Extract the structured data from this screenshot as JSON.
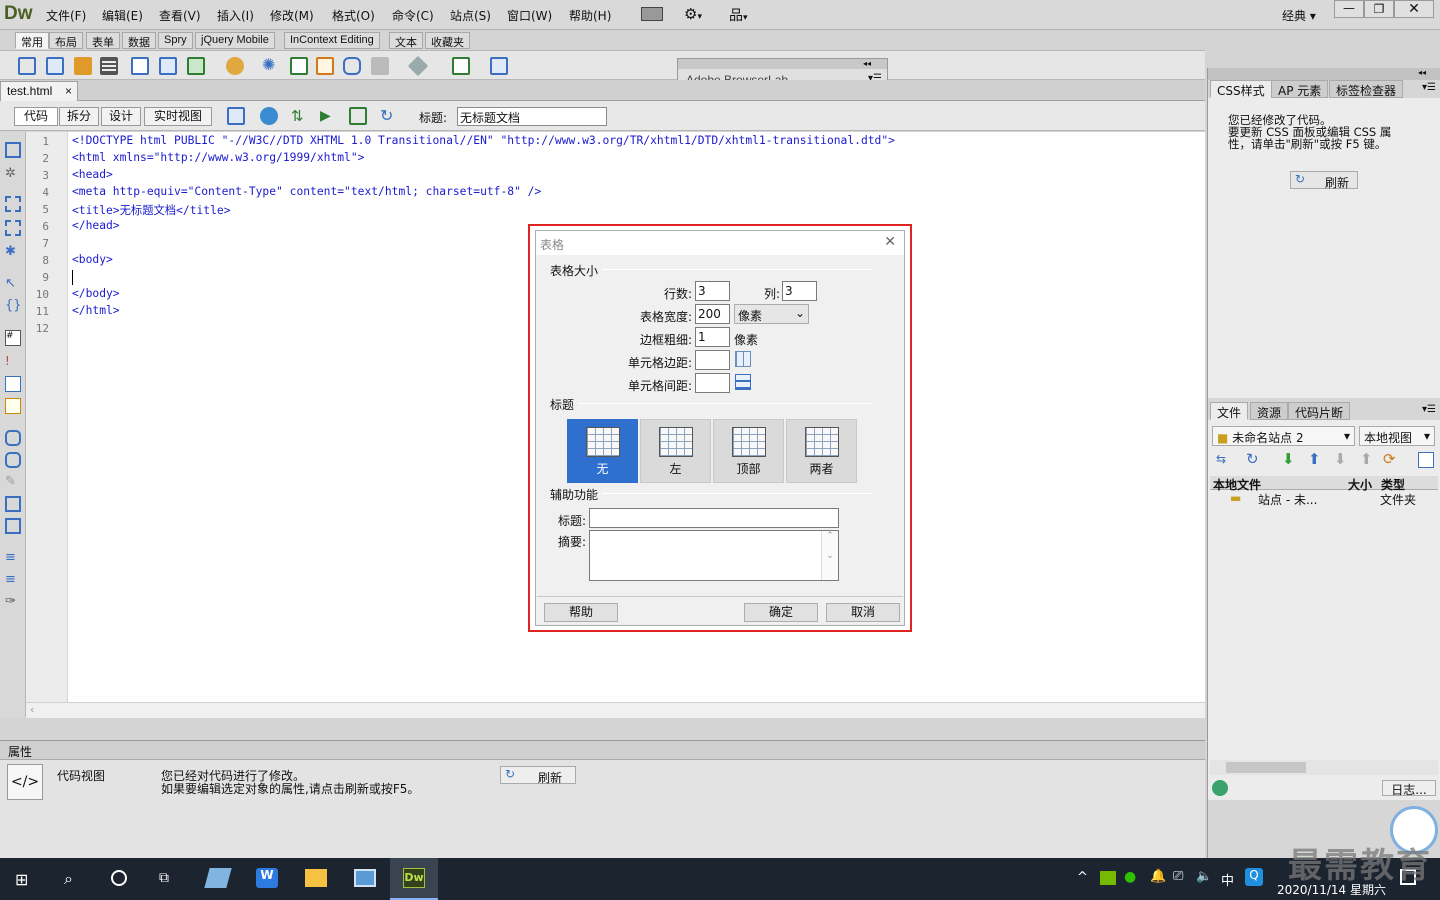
{
  "app": {
    "logo": "Dw",
    "workspace": "经典 ▾"
  },
  "menu": [
    "文件(F)",
    "编辑(E)",
    "查看(V)",
    "插入(I)",
    "修改(M)",
    "格式(O)",
    "命令(C)",
    "站点(S)",
    "窗口(W)",
    "帮助(H)"
  ],
  "insert_tabs": [
    "常用",
    "布局",
    "表单",
    "数据",
    "Spry",
    "jQuery Mobile",
    "InContext Editing",
    "文本",
    "收藏夹"
  ],
  "browserlab_panel": "Adobe BrowserLab",
  "document": {
    "tab": "test.html",
    "close": "×"
  },
  "view_buttons": [
    "代码",
    "拆分",
    "设计",
    "实时视图"
  ],
  "title_label": "标题:",
  "title_value": "无标题文档",
  "code_lines": [
    "<!DOCTYPE html PUBLIC \"-//W3C//DTD XHTML 1.0 Transitional//EN\" \"http://www.w3.org/TR/xhtml1/DTD/xhtml1-transitional.dtd\">",
    "<html xmlns=\"http://www.w3.org/1999/xhtml\">",
    "<head>",
    "<meta http-equiv=\"Content-Type\" content=\"text/html; charset=utf-8\" />",
    "<title>无标题文档</title>",
    "</head>",
    "",
    "<body>",
    "",
    "</body>",
    "</html>",
    ""
  ],
  "line_numbers": [
    "1",
    "2",
    "3",
    "4",
    "5",
    "6",
    "7",
    "8",
    "9",
    "10",
    "11",
    "12"
  ],
  "dialog": {
    "title": "表格",
    "group_size": "表格大小",
    "rows_label": "行数:",
    "rows_value": "3",
    "cols_label": "列:",
    "cols_value": "3",
    "width_label": "表格宽度:",
    "width_value": "200",
    "width_unit": "像素",
    "border_label": "边框粗细:",
    "border_value": "1",
    "border_unit": "像素",
    "padding_label": "单元格边距:",
    "padding_value": "",
    "spacing_label": "单元格间距:",
    "spacing_value": "",
    "group_header": "标题",
    "header_options": [
      "无",
      "左",
      "顶部",
      "两者"
    ],
    "header_selected": "无",
    "group_access": "辅助功能",
    "caption_label": "标题:",
    "caption_value": "",
    "summary_label": "摘要:",
    "summary_value": "",
    "help_btn": "帮助",
    "ok_btn": "确定",
    "cancel_btn": "取消"
  },
  "css_panel": {
    "tabs": [
      "CSS样式",
      "AP 元素",
      "标签检查器"
    ],
    "message": "您已经修改了代码。\n要更新 CSS 面板或编辑 CSS 属性，请单击\"刷新\"或按 F5 键。",
    "refresh": "刷新"
  },
  "files_panel": {
    "tabs": [
      "文件",
      "资源",
      "代码片断"
    ],
    "site": "未命名站点 2",
    "view": "本地视图",
    "col_local": "本地文件",
    "col_size": "大小",
    "col_type": "类型",
    "row_name": "站点 - 未...",
    "row_type": "文件夹",
    "log_btn": "日志..."
  },
  "properties": {
    "header": "属性",
    "code_view_label": "代码视图",
    "message_line1": "您已经对代码进行了修改。",
    "message_line2": "如果要编辑选定对象的属性,请点击刷新或按F5。",
    "refresh": "刷新"
  },
  "taskbar": {
    "time": "2020/11/14 星期六",
    "ime": "中"
  },
  "watermark": "最需教育",
  "colors": {
    "accent": "#2f6fce",
    "highlight_border": "#e02424",
    "code_blue": "#1b1bd0"
  }
}
